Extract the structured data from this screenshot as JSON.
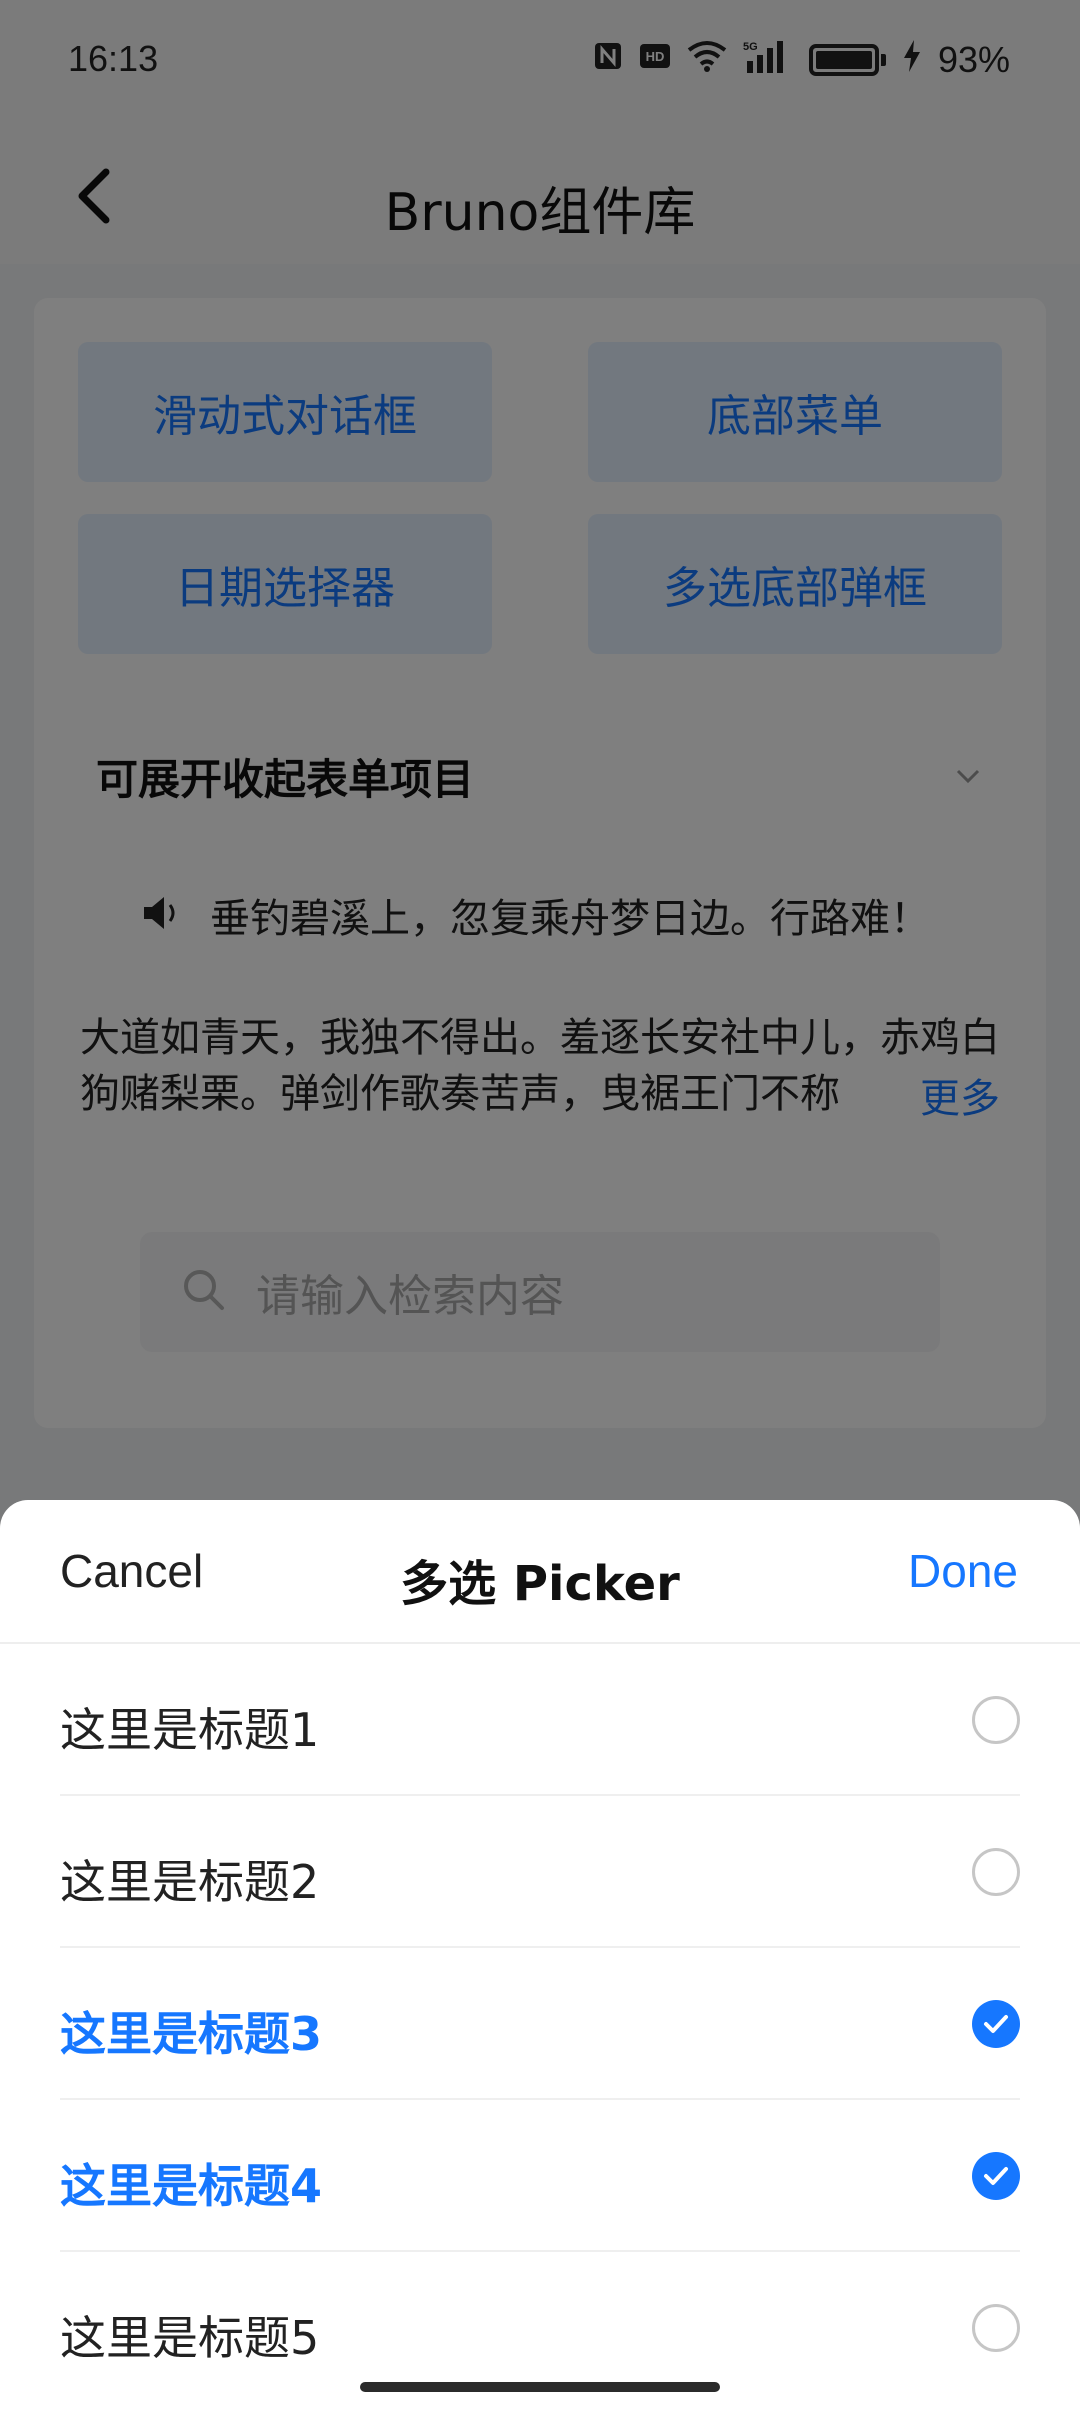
{
  "status_bar": {
    "time": "16:13",
    "network_label": "5G",
    "battery_percent": "93%",
    "icons": [
      "nfc-icon",
      "hd-icon",
      "wifi-icon",
      "signal-icon",
      "battery-icon",
      "charging-icon"
    ]
  },
  "nav": {
    "title": "Bruno组件库",
    "back_icon": "chevron-left-icon"
  },
  "demo_buttons": [
    "滑动式对话框",
    "底部菜单",
    "日期选择器",
    "多选底部弹框"
  ],
  "expandable": {
    "label": "可展开收起表单项目",
    "icon": "chevron-down-icon"
  },
  "notice_bar": {
    "icon": "speaker-icon",
    "text": "垂钓碧溪上，忽复乘舟梦日边。行路难！"
  },
  "poem": {
    "text": "大道如青天，我独不得出。羞逐长安社中儿，赤鸡白狗赌梨栗。弹剑作歌奏苦声，曳裾王门不称",
    "more_label": "更多"
  },
  "search": {
    "placeholder": "请输入检索内容",
    "icon": "search-icon"
  },
  "picker": {
    "cancel_label": "Cancel",
    "title": "多选 Picker",
    "done_label": "Done",
    "options": [
      {
        "label": "这里是标题1",
        "checked": false
      },
      {
        "label": "这里是标题2",
        "checked": false
      },
      {
        "label": "这里是标题3",
        "checked": true
      },
      {
        "label": "这里是标题4",
        "checked": true
      },
      {
        "label": "这里是标题5",
        "checked": false
      }
    ]
  },
  "colors": {
    "accent": "#1677ff",
    "overlay": "rgba(0,0,0,0.5)"
  }
}
